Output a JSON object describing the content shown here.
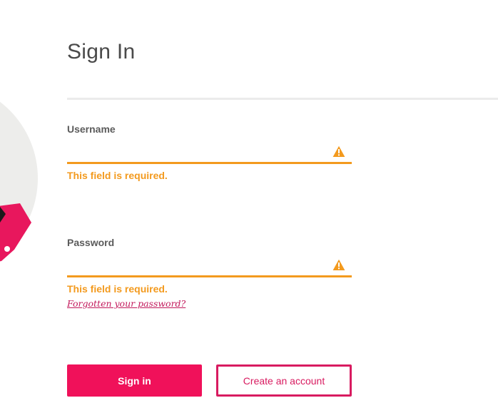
{
  "page": {
    "title": "Sign In"
  },
  "username": {
    "label": "Username",
    "value": "",
    "error": "This field is required."
  },
  "password": {
    "label": "Password",
    "value": "",
    "error": "This field is required.",
    "forgot_link": "Forgotten your password?"
  },
  "buttons": {
    "sign_in": "Sign in",
    "create_account": "Create an account"
  },
  "icons": {
    "warning": "warning-icon",
    "illustration": "decorative-circle-illustration"
  },
  "colors": {
    "accent": "#f0115a",
    "secondary_accent": "#d81b60",
    "warning": "#f39a1e",
    "illustration_bg": "#ededeb"
  }
}
